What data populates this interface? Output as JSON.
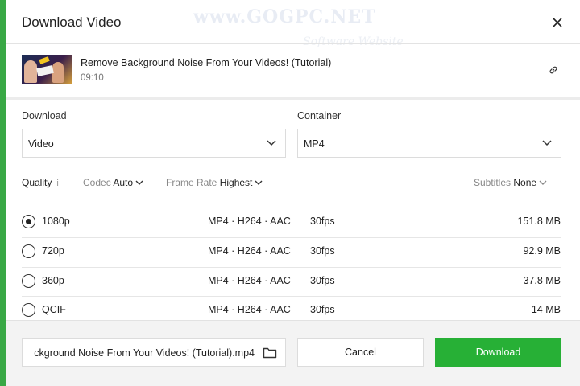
{
  "watermark": {
    "main": "www.GOGPC.NET",
    "sub": "Software Website"
  },
  "dialog": {
    "title": "Download Video",
    "close_icon": "close-icon"
  },
  "video": {
    "title": "Remove Background Noise From Your Videos! (Tutorial)",
    "duration": "09:10",
    "link_icon": "link-icon"
  },
  "download": {
    "label": "Download",
    "value": "Video"
  },
  "container": {
    "label": "Container",
    "value": "MP4"
  },
  "options": {
    "quality_label": "Quality",
    "quality_info": "i",
    "codec_label": "Codec",
    "codec_value": "Auto",
    "frame_rate_label": "Frame Rate",
    "frame_rate_value": "Highest",
    "subtitles_label": "Subtitles",
    "subtitles_value": "None"
  },
  "qualities": [
    {
      "resolution": "1080p",
      "format": "MP4 · H264 · AAC",
      "fps": "30fps",
      "size": "151.8 MB",
      "selected": true
    },
    {
      "resolution": "720p",
      "format": "MP4 · H264 · AAC",
      "fps": "30fps",
      "size": "92.9 MB",
      "selected": false
    },
    {
      "resolution": "360p",
      "format": "MP4 · H264 · AAC",
      "fps": "30fps",
      "size": "37.8 MB",
      "selected": false
    },
    {
      "resolution": "QCIF",
      "format": "MP4 · H264 · AAC",
      "fps": "30fps",
      "size": "14 MB",
      "selected": false
    }
  ],
  "footer": {
    "filename": "ckground Noise From Your Videos! (Tutorial).mp4",
    "folder_icon": "folder-icon",
    "cancel_label": "Cancel",
    "download_label": "Download"
  },
  "colors": {
    "accent": "#27b036",
    "text": "#222222",
    "muted": "#888888"
  }
}
